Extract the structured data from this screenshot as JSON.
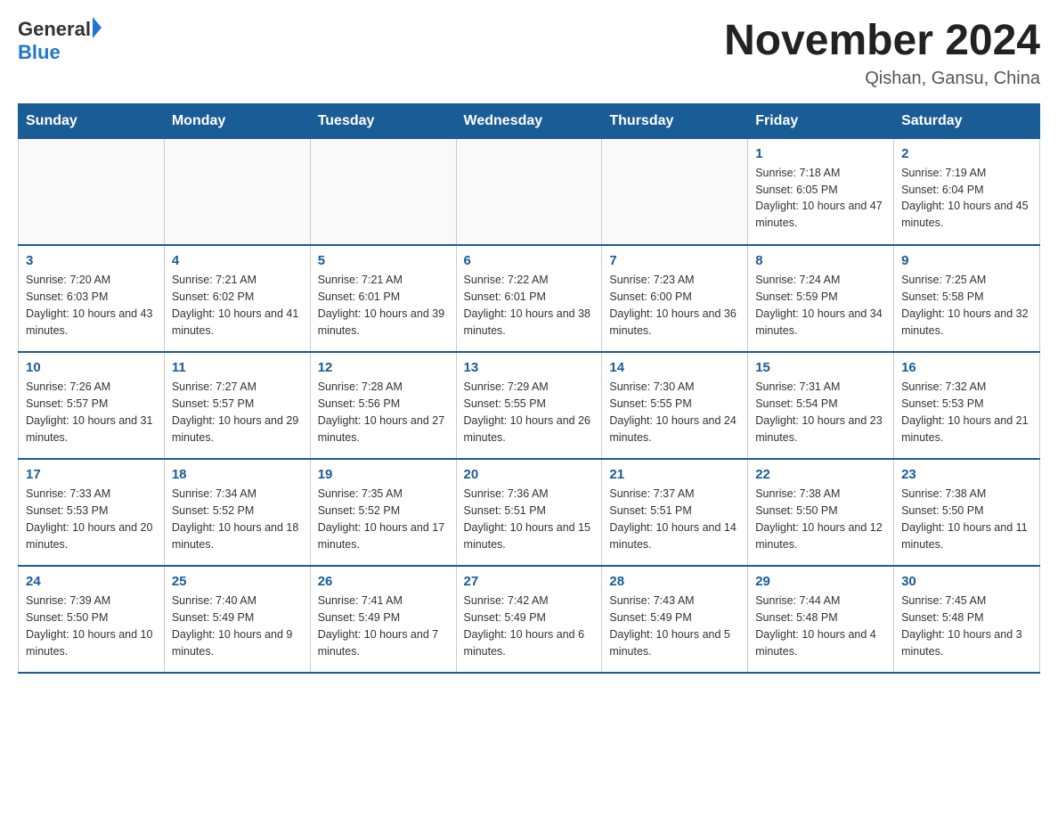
{
  "header": {
    "logo_general": "General",
    "logo_blue": "Blue",
    "title": "November 2024",
    "subtitle": "Qishan, Gansu, China"
  },
  "weekdays": [
    "Sunday",
    "Monday",
    "Tuesday",
    "Wednesday",
    "Thursday",
    "Friday",
    "Saturday"
  ],
  "weeks": [
    [
      {
        "day": "",
        "info": ""
      },
      {
        "day": "",
        "info": ""
      },
      {
        "day": "",
        "info": ""
      },
      {
        "day": "",
        "info": ""
      },
      {
        "day": "",
        "info": ""
      },
      {
        "day": "1",
        "info": "Sunrise: 7:18 AM\nSunset: 6:05 PM\nDaylight: 10 hours and 47 minutes."
      },
      {
        "day": "2",
        "info": "Sunrise: 7:19 AM\nSunset: 6:04 PM\nDaylight: 10 hours and 45 minutes."
      }
    ],
    [
      {
        "day": "3",
        "info": "Sunrise: 7:20 AM\nSunset: 6:03 PM\nDaylight: 10 hours and 43 minutes."
      },
      {
        "day": "4",
        "info": "Sunrise: 7:21 AM\nSunset: 6:02 PM\nDaylight: 10 hours and 41 minutes."
      },
      {
        "day": "5",
        "info": "Sunrise: 7:21 AM\nSunset: 6:01 PM\nDaylight: 10 hours and 39 minutes."
      },
      {
        "day": "6",
        "info": "Sunrise: 7:22 AM\nSunset: 6:01 PM\nDaylight: 10 hours and 38 minutes."
      },
      {
        "day": "7",
        "info": "Sunrise: 7:23 AM\nSunset: 6:00 PM\nDaylight: 10 hours and 36 minutes."
      },
      {
        "day": "8",
        "info": "Sunrise: 7:24 AM\nSunset: 5:59 PM\nDaylight: 10 hours and 34 minutes."
      },
      {
        "day": "9",
        "info": "Sunrise: 7:25 AM\nSunset: 5:58 PM\nDaylight: 10 hours and 32 minutes."
      }
    ],
    [
      {
        "day": "10",
        "info": "Sunrise: 7:26 AM\nSunset: 5:57 PM\nDaylight: 10 hours and 31 minutes."
      },
      {
        "day": "11",
        "info": "Sunrise: 7:27 AM\nSunset: 5:57 PM\nDaylight: 10 hours and 29 minutes."
      },
      {
        "day": "12",
        "info": "Sunrise: 7:28 AM\nSunset: 5:56 PM\nDaylight: 10 hours and 27 minutes."
      },
      {
        "day": "13",
        "info": "Sunrise: 7:29 AM\nSunset: 5:55 PM\nDaylight: 10 hours and 26 minutes."
      },
      {
        "day": "14",
        "info": "Sunrise: 7:30 AM\nSunset: 5:55 PM\nDaylight: 10 hours and 24 minutes."
      },
      {
        "day": "15",
        "info": "Sunrise: 7:31 AM\nSunset: 5:54 PM\nDaylight: 10 hours and 23 minutes."
      },
      {
        "day": "16",
        "info": "Sunrise: 7:32 AM\nSunset: 5:53 PM\nDaylight: 10 hours and 21 minutes."
      }
    ],
    [
      {
        "day": "17",
        "info": "Sunrise: 7:33 AM\nSunset: 5:53 PM\nDaylight: 10 hours and 20 minutes."
      },
      {
        "day": "18",
        "info": "Sunrise: 7:34 AM\nSunset: 5:52 PM\nDaylight: 10 hours and 18 minutes."
      },
      {
        "day": "19",
        "info": "Sunrise: 7:35 AM\nSunset: 5:52 PM\nDaylight: 10 hours and 17 minutes."
      },
      {
        "day": "20",
        "info": "Sunrise: 7:36 AM\nSunset: 5:51 PM\nDaylight: 10 hours and 15 minutes."
      },
      {
        "day": "21",
        "info": "Sunrise: 7:37 AM\nSunset: 5:51 PM\nDaylight: 10 hours and 14 minutes."
      },
      {
        "day": "22",
        "info": "Sunrise: 7:38 AM\nSunset: 5:50 PM\nDaylight: 10 hours and 12 minutes."
      },
      {
        "day": "23",
        "info": "Sunrise: 7:38 AM\nSunset: 5:50 PM\nDaylight: 10 hours and 11 minutes."
      }
    ],
    [
      {
        "day": "24",
        "info": "Sunrise: 7:39 AM\nSunset: 5:50 PM\nDaylight: 10 hours and 10 minutes."
      },
      {
        "day": "25",
        "info": "Sunrise: 7:40 AM\nSunset: 5:49 PM\nDaylight: 10 hours and 9 minutes."
      },
      {
        "day": "26",
        "info": "Sunrise: 7:41 AM\nSunset: 5:49 PM\nDaylight: 10 hours and 7 minutes."
      },
      {
        "day": "27",
        "info": "Sunrise: 7:42 AM\nSunset: 5:49 PM\nDaylight: 10 hours and 6 minutes."
      },
      {
        "day": "28",
        "info": "Sunrise: 7:43 AM\nSunset: 5:49 PM\nDaylight: 10 hours and 5 minutes."
      },
      {
        "day": "29",
        "info": "Sunrise: 7:44 AM\nSunset: 5:48 PM\nDaylight: 10 hours and 4 minutes."
      },
      {
        "day": "30",
        "info": "Sunrise: 7:45 AM\nSunset: 5:48 PM\nDaylight: 10 hours and 3 minutes."
      }
    ]
  ]
}
